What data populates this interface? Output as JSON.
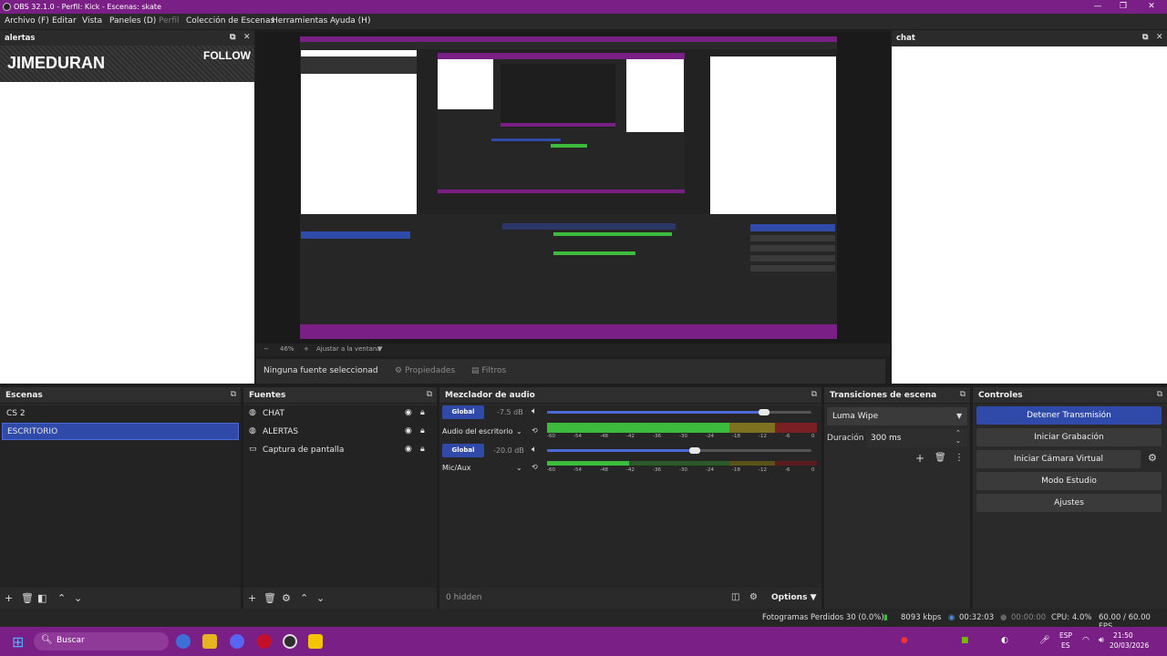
{
  "window": {
    "title": "OBS 32.1.0 - Perfil: Kick - Escenas: skate",
    "controls": [
      "—",
      "❐",
      "✕"
    ]
  },
  "menu": {
    "items": [
      "Archivo (F)",
      "Editar",
      "Vista",
      "Paneles (D)",
      "Perfil",
      "Colección de Escenas",
      "Herramientas",
      "Ayuda (H)"
    ]
  },
  "docks": {
    "alertas": {
      "title": "alertas",
      "streamer": "JIMEDURAN",
      "follow": "FOLLOW"
    },
    "chat": {
      "title": "chat"
    }
  },
  "preview": {
    "zoom": "46%",
    "fit": "Ajustar a la ventana"
  },
  "properties_bar": {
    "no_source": "Ninguna fuente seleccionad",
    "properties": "Propiedades",
    "filters": "Filtros"
  },
  "scenes": {
    "title": "Escenas",
    "items": [
      "CS 2",
      "ESCRITORIO"
    ],
    "selected": "ESCRITORIO"
  },
  "sources": {
    "title": "Fuentes",
    "items": [
      "CHAT",
      "ALERTAS",
      "Captura de pantalla"
    ]
  },
  "mixer": {
    "title": "Mezclador de audio",
    "channels": [
      {
        "global_label": "Global",
        "db": "-7.5 dB",
        "name": "Audio del escritorio",
        "level": 0.82
      },
      {
        "global_label": "Global",
        "db": "-20.0 dB",
        "name": "Mic/Aux",
        "level": 0.56
      }
    ],
    "scale": [
      "-60",
      "-54",
      "-48",
      "-42",
      "-36",
      "-30",
      "-24",
      "-18",
      "-12",
      "-6",
      "0"
    ],
    "hidden": "0 hidden",
    "options": "Options"
  },
  "transitions": {
    "title": "Transiciones de escena",
    "selected": "Luma Wipe",
    "duration_label": "Duración",
    "duration_value": "300 ms"
  },
  "controls": {
    "title": "Controles",
    "stop_stream": "Detener Transmisión",
    "start_record": "Iniciar Grabación",
    "start_vcam": "Iniciar Cámara Virtual",
    "studio_mode": "Modo Estudio",
    "settings": "Ajustes"
  },
  "status": {
    "dropped": "Fotogramas Perdidos 30 (0.0%)",
    "bitrate": "8093 kbps",
    "stream_time": "00:32:03",
    "rec_time": "00:00:00",
    "cpu": "CPU: 4.0%",
    "fps": "60.00 / 60.00 FPS"
  },
  "taskbar": {
    "search": "Buscar",
    "lang1": "ESP",
    "lang2": "ES",
    "time": "21:50",
    "date": "20/03/2026"
  },
  "colors": {
    "accent": "#2f4aa8",
    "titlebar": "#7a1f86",
    "meter_green": "#3dbb3d",
    "meter_yellow": "#9a8a22",
    "meter_red": "#8a2222"
  }
}
